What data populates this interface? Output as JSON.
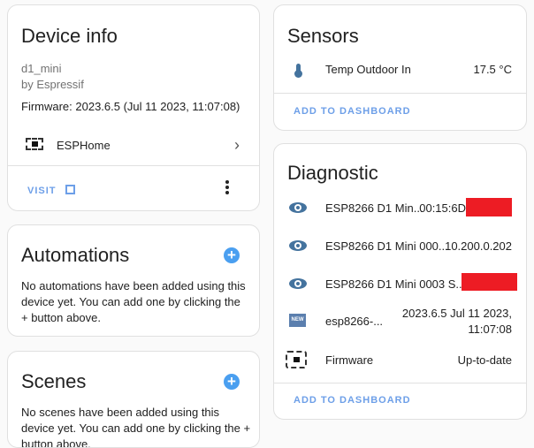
{
  "device_info": {
    "title": "Device info",
    "model": "d1_mini",
    "manufacturer": "by Espressif",
    "firmware": "Firmware: 2023.6.5 (Jul 11 2023, 11:07:08)",
    "integration": "ESPHome",
    "visit_label": "VISIT"
  },
  "automations": {
    "title": "Automations",
    "text": "No automations have been added using this device yet. You can add one by clicking the + button above."
  },
  "scenes": {
    "title": "Scenes",
    "text": "No scenes have been added using this device yet. You can add one by clicking the + button above."
  },
  "sensors": {
    "title": "Sensors",
    "items": [
      {
        "name": "Temp Outdoor In",
        "value": "17.5 °C",
        "icon": "thermometer-icon"
      }
    ],
    "add_label": "ADD TO DASHBOARD"
  },
  "diagnostic": {
    "title": "Diagnostic",
    "items": [
      {
        "name": "ESP8266 D1 Min...",
        "value": "00:15:6D",
        "icon": "eye-icon"
      },
      {
        "name": "ESP8266 D1 Mini 000...",
        "value": "10.200.0.202",
        "icon": "eye-icon"
      },
      {
        "name": "ESP8266 D1 Mini 0003 S...",
        "value": "",
        "icon": "eye-icon"
      },
      {
        "name": "esp8266-...",
        "value": "2023.6.5 Jul 11 2023,",
        "value2": "11:07:08",
        "icon": "new-icon"
      },
      {
        "name": "Firmware",
        "value": "Up-to-date",
        "icon": "esphome-chip-icon"
      }
    ],
    "add_label": "ADD TO DASHBOARD"
  },
  "colors": {
    "accent": "#4a9ff0",
    "icon": "#44739e",
    "redact": "#ed1c24"
  }
}
